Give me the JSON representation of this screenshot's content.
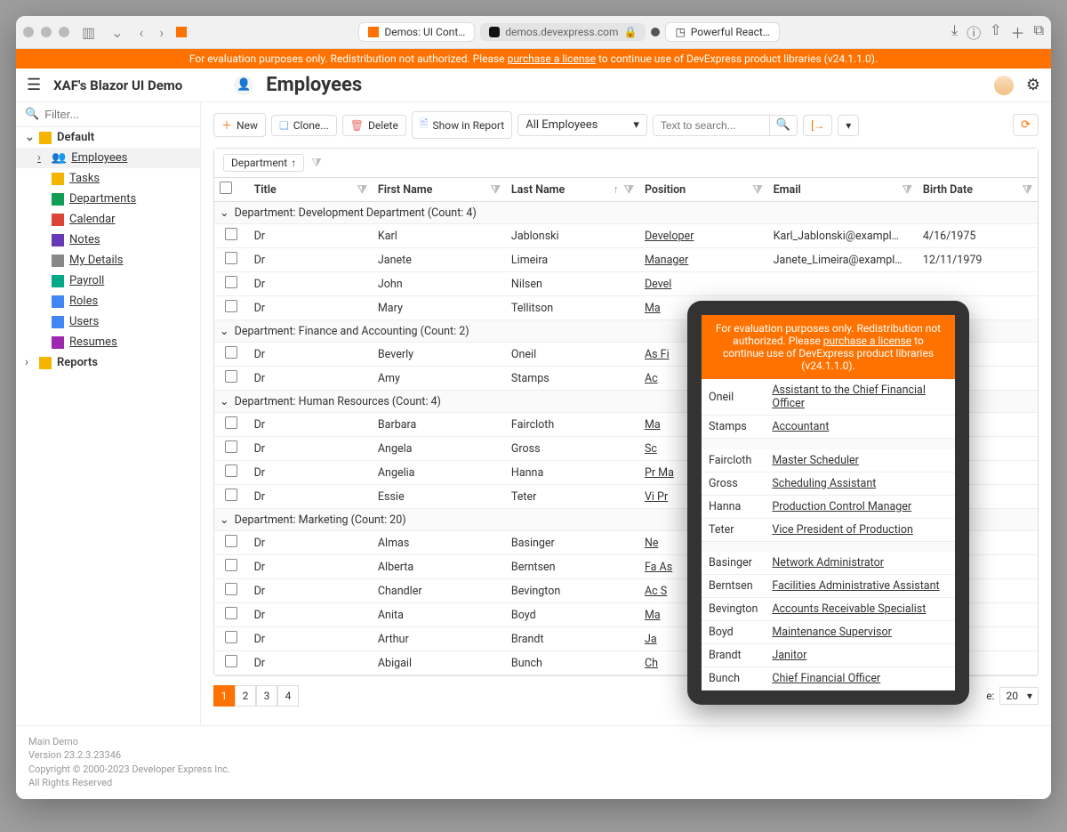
{
  "chrome": {
    "tab1": "Demos: UI Cont…",
    "url": "demos.devexpress.com",
    "tab2": "Powerful React…"
  },
  "banner": {
    "t1": "For evaluation purposes only. Redistribution not authorized. Please ",
    "link": "purchase a license",
    "t2": " to continue use of DevExpress product libraries (v24.1.1.0)."
  },
  "header": {
    "title": "XAF's Blazor UI Demo"
  },
  "sidebar": {
    "filter_ph": "Filter...",
    "groups": [
      {
        "name": "Default"
      },
      {
        "name": "Reports"
      }
    ],
    "items": [
      {
        "label": "Employees"
      },
      {
        "label": "Tasks"
      },
      {
        "label": "Departments"
      },
      {
        "label": "Calendar"
      },
      {
        "label": "Notes"
      },
      {
        "label": "My Details"
      },
      {
        "label": "Payroll"
      },
      {
        "label": "Roles"
      },
      {
        "label": "Users"
      },
      {
        "label": "Resumes"
      }
    ]
  },
  "page": {
    "title": "Employees"
  },
  "toolbar": {
    "new": "New",
    "clone": "Clone...",
    "delete": "Delete",
    "show_report": "Show in Report",
    "views_dd": "All Employees",
    "search_ph": "Text to search..."
  },
  "grid": {
    "group_chip": "Department",
    "cols": {
      "title": "Title",
      "first": "First Name",
      "last": "Last Name",
      "pos": "Position",
      "email": "Email",
      "bd": "Birth Date"
    },
    "groups": [
      {
        "name": "Department: Development Department (Count: 4)",
        "rows": [
          {
            "title": "Dr",
            "first": "Karl",
            "last": "Jablonski",
            "pos": "Developer",
            "email": "Karl_Jablonski@exampl…",
            "bd": "4/16/1975"
          },
          {
            "title": "Dr",
            "first": "Janete",
            "last": "Limeira",
            "pos": "Manager",
            "email": "Janete_Limeira@exampl…",
            "bd": "12/11/1979"
          },
          {
            "title": "Dr",
            "first": "John",
            "last": "Nilsen",
            "pos": "Devel",
            "email": "",
            "bd": ""
          },
          {
            "title": "Dr",
            "first": "Mary",
            "last": "Tellitson",
            "pos": "Ma",
            "email": "",
            "bd": ""
          }
        ]
      },
      {
        "name": "Department: Finance and Accounting (Count: 2)",
        "rows": [
          {
            "title": "Dr",
            "first": "Beverly",
            "last": "Oneil",
            "pos": "As\nFi",
            "email": "",
            "bd": ""
          },
          {
            "title": "Dr",
            "first": "Amy",
            "last": "Stamps",
            "pos": "Ac",
            "email": "",
            "bd": ""
          }
        ]
      },
      {
        "name": "Department: Human Resources (Count: 4)",
        "rows": [
          {
            "title": "Dr",
            "first": "Barbara",
            "last": "Faircloth",
            "pos": "Ma",
            "email": "",
            "bd": ""
          },
          {
            "title": "Dr",
            "first": "Angela",
            "last": "Gross",
            "pos": "Sc",
            "email": "",
            "bd": ""
          },
          {
            "title": "Dr",
            "first": "Angelia",
            "last": "Hanna",
            "pos": "Pr\nMa",
            "email": "",
            "bd": ""
          },
          {
            "title": "Dr",
            "first": "Essie",
            "last": "Teter",
            "pos": "Vi\nPr",
            "email": "",
            "bd": ""
          }
        ]
      },
      {
        "name": "Department: Marketing (Count: 20)",
        "rows": [
          {
            "title": "Dr",
            "first": "Almas",
            "last": "Basinger",
            "pos": "Ne",
            "email": "",
            "bd": ""
          },
          {
            "title": "Dr",
            "first": "Alberta",
            "last": "Berntsen",
            "pos": "Fa\nAs",
            "email": "",
            "bd": ""
          },
          {
            "title": "Dr",
            "first": "Chandler",
            "last": "Bevington",
            "pos": "Ac\nS",
            "email": "",
            "bd": ""
          },
          {
            "title": "Dr",
            "first": "Anita",
            "last": "Boyd",
            "pos": "Ma",
            "email": "",
            "bd": ""
          },
          {
            "title": "Dr",
            "first": "Arthur",
            "last": "Brandt",
            "pos": "Ja",
            "email": "",
            "bd": ""
          },
          {
            "title": "Dr",
            "first": "Abigail",
            "last": "Bunch",
            "pos": "Ch",
            "email": "",
            "bd": ""
          }
        ]
      }
    ],
    "pages": [
      "1",
      "2",
      "3",
      "4"
    ],
    "page_size_label": "Page Size:",
    "page_size_value": "20",
    "page_size_value_visible": "20"
  },
  "popup": {
    "banner": {
      "t1": "For evaluation purposes only. Redistribution not authorized. Please ",
      "link": "purchase a license",
      "t2": " to continue use of DevExpress product libraries (v24.1.1.0)."
    },
    "rows": [
      {
        "last": "Oneil",
        "pos": "Assistant to the Chief Financial Officer"
      },
      {
        "last": "Stamps",
        "pos": "Accountant"
      },
      {
        "spacer": true
      },
      {
        "last": "Faircloth",
        "pos": "Master Scheduler"
      },
      {
        "last": "Gross",
        "pos": "Scheduling Assistant"
      },
      {
        "last": "Hanna",
        "pos": "Production Control Manager"
      },
      {
        "last": "Teter",
        "pos": "Vice President of Production"
      },
      {
        "spacer": true
      },
      {
        "last": "Basinger",
        "pos": "Network Administrator"
      },
      {
        "last": "Berntsen",
        "pos": "Facilities Administrative Assistant"
      },
      {
        "last": "Bevington",
        "pos": "Accounts Receivable Specialist"
      },
      {
        "last": "Boyd",
        "pos": "Maintenance Supervisor"
      },
      {
        "last": "Brandt",
        "pos": "Janitor"
      },
      {
        "last": "Bunch",
        "pos": "Chief Financial Officer"
      }
    ]
  },
  "footer": {
    "l1": "Main Demo",
    "l2": "Version 23.2.3.23346",
    "l3": "Copyright © 2000-2023 Developer Express Inc.",
    "l4": "All Rights Reserved"
  }
}
